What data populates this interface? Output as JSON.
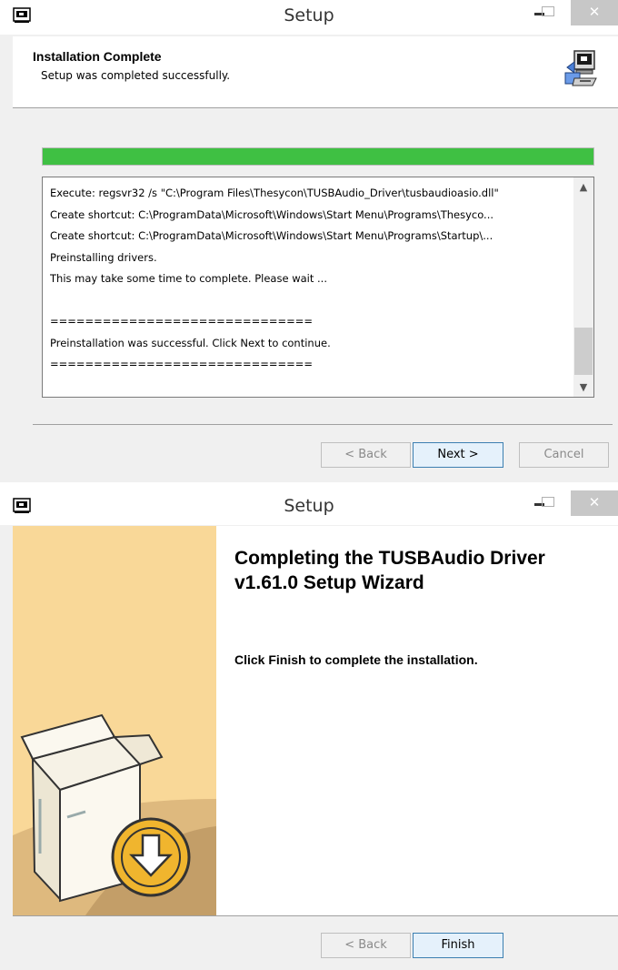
{
  "window1": {
    "title": "Setup",
    "header_title": "Installation Complete",
    "header_subtitle": "Setup was completed successfully.",
    "progress_percent": 100,
    "log_lines": [
      "Execute: regsvr32 /s \"C:\\Program Files\\Thesycon\\TUSBAudio_Driver\\tusbaudioasio.dll\"",
      "Create shortcut: C:\\ProgramData\\Microsoft\\Windows\\Start Menu\\Programs\\Thesyco...",
      "Create shortcut: C:\\ProgramData\\Microsoft\\Windows\\Start Menu\\Programs\\Startup\\...",
      "Preinstalling drivers.",
      "This may take some time to complete. Please wait ...",
      "",
      "==============================",
      "Preinstallation was successful. Click Next to continue.",
      "=============================="
    ],
    "buttons": {
      "back": "< Back",
      "next": "Next >",
      "cancel": "Cancel"
    }
  },
  "window2": {
    "title": "Setup",
    "heading": "Completing the TUSBAudio Driver\nv1.61.0 Setup Wizard",
    "body": "Click Finish to complete the installation.",
    "buttons": {
      "back": "< Back",
      "finish": "Finish"
    }
  },
  "colors": {
    "progress_fill": "#3fc043",
    "banner_bg": "#f9d898",
    "close_button": "#c7c7c7"
  },
  "icons": [
    "app-window-icon",
    "minimize-icon",
    "maximize-icon",
    "close-icon",
    "installer-computer-icon",
    "scroll-up-icon",
    "scroll-down-icon",
    "box-download-icon"
  ]
}
